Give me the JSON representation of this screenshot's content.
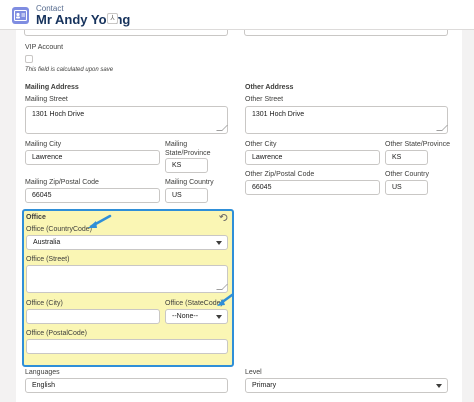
{
  "header": {
    "object_label": "Contact",
    "record_name": "Mr Andy Young",
    "hierarchy_symbol": "⅄",
    "icon": "contact-card-icon"
  },
  "form": {
    "vip": {
      "label": "VIP Account",
      "checked": false,
      "hint": "This field is calculated upon save"
    },
    "mailing_section": "Mailing Address",
    "other_section": "Other Address",
    "mailing_street": {
      "label": "Mailing Street",
      "value": "1301 Hoch Drive"
    },
    "mailing_city": {
      "label": "Mailing City",
      "value": "Lawrence"
    },
    "mailing_state": {
      "label": "Mailing State/Province",
      "value": "KS"
    },
    "mailing_zip": {
      "label": "Mailing Zip/Postal Code",
      "value": "66045"
    },
    "mailing_country": {
      "label": "Mailing Country",
      "value": "US"
    },
    "other_street": {
      "label": "Other Street",
      "value": "1301 Hoch Drive"
    },
    "other_city": {
      "label": "Other City",
      "value": "Lawrence"
    },
    "other_state": {
      "label": "Other State/Province",
      "value": "KS"
    },
    "other_zip": {
      "label": "Other Zip/Postal Code",
      "value": "66045"
    },
    "other_country": {
      "label": "Other Country",
      "value": "US"
    },
    "office_section": "Office",
    "office_country": {
      "label": "Office (CountryCode)",
      "value": "Australia"
    },
    "office_street": {
      "label": "Office (Street)",
      "value": ""
    },
    "office_city": {
      "label": "Office (City)",
      "value": ""
    },
    "office_state": {
      "label": "Office (StateCode)",
      "value": "--None--"
    },
    "office_postal": {
      "label": "Office (PostalCode)",
      "value": ""
    },
    "languages": {
      "label": "Languages",
      "value": "English"
    },
    "level": {
      "label": "Level",
      "value": "Primary"
    }
  },
  "colors": {
    "highlight": "#faf6b4",
    "annotation_blue": "#2f8fd8",
    "header_icon": "#7f8de1"
  }
}
